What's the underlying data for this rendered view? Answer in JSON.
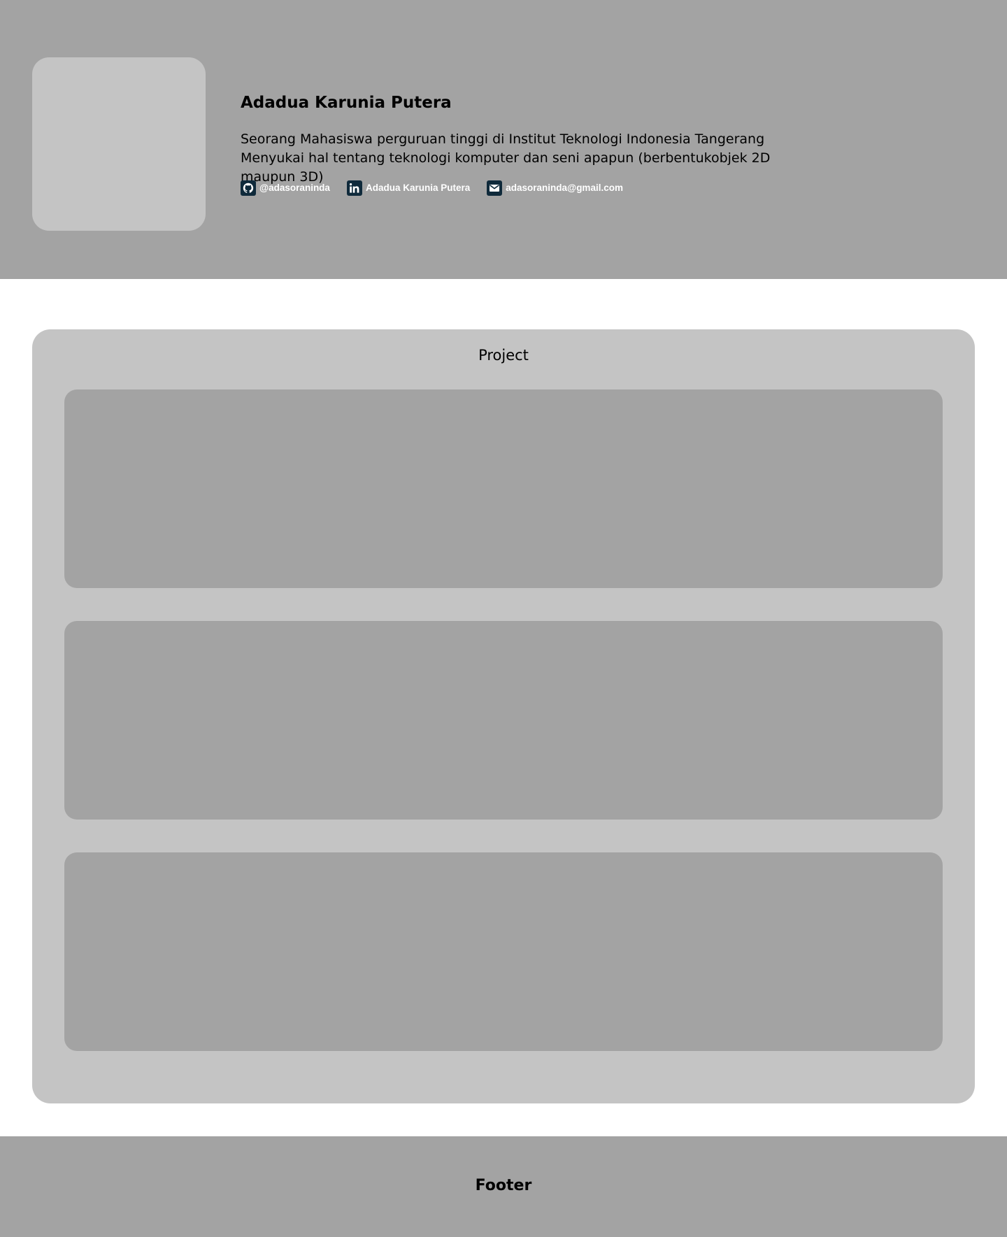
{
  "colors": {
    "header_bg": "#a3a3a3",
    "panel_bg": "#c4c4c4",
    "card_bg": "#a3a3a3",
    "icon_bg": "#0f2a3b",
    "link_text": "#ffffff"
  },
  "profile": {
    "name": "Adadua Karunia Putera",
    "bio": "Seorang Mahasiswa perguruan tinggi di Institut Teknologi Indonesia Tangerang Menyukai hal tentang teknologi komputer dan seni apapun (berbentukobjek 2D maupun 3D)",
    "socials": [
      {
        "icon": "github-icon",
        "label": "@adasoraninda"
      },
      {
        "icon": "linkedin-icon",
        "label": "Adadua Karunia Putera"
      },
      {
        "icon": "mail-icon",
        "label": "adasoraninda@gmail.com"
      }
    ]
  },
  "projects": {
    "title": "Project",
    "cards": [
      {
        "label": ""
      },
      {
        "label": ""
      },
      {
        "label": ""
      }
    ]
  },
  "footer": {
    "text": "Footer"
  }
}
